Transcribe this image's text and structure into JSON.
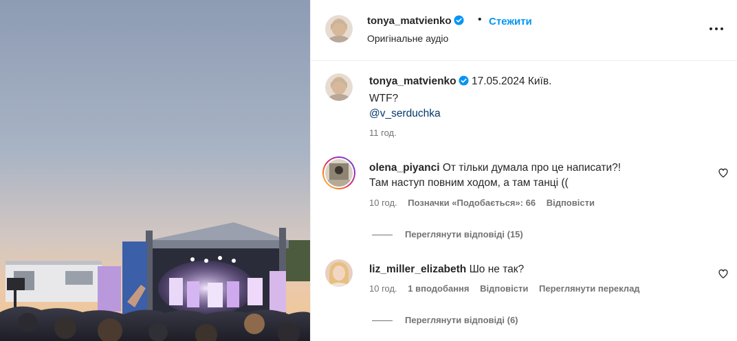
{
  "post": {
    "author": "tonya_matvienko",
    "follow_label": "Стежити",
    "separator": "•",
    "audio": "Оригінальне аудіо",
    "verified_icon": "verified-badge-icon",
    "more_icon": "more-options-icon"
  },
  "caption": {
    "username": "tonya_matvienko",
    "date_place": "17.05.2024 Київ.",
    "text": "WTF?",
    "mention": "@v_serduchka",
    "time": "11 год."
  },
  "comments": [
    {
      "username": "olena_piyanci",
      "text_line1": "От тільки думала про це написати?!",
      "text_line2": "Там наступ повним ходом, а там танці ((",
      "time": "10 год.",
      "likes": "Позначки «Подобається»: 66",
      "reply": "Відповісти",
      "view_replies": "Переглянути відповіді (15)"
    },
    {
      "username": "liz_miller_elizabeth",
      "text_line1": "Шо не так?",
      "time": "10 год.",
      "likes": "1 вподобання",
      "reply": "Відповісти",
      "translate": "Переглянути переклад",
      "view_replies": "Переглянути відповіді (6)"
    }
  ],
  "colors": {
    "link_blue": "#0095f6",
    "mention": "#00376b",
    "secondary": "#737373",
    "text": "#262626"
  }
}
